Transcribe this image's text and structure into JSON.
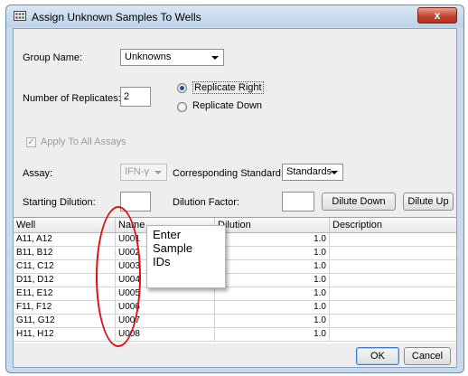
{
  "window": {
    "title": "Assign Unknown Samples To Wells",
    "close_glyph": "x",
    "icon": "plate-icon"
  },
  "form": {
    "group_name_label": "Group Name:",
    "group_name_value": "Unknowns",
    "replicates_label": "Number of Replicates:",
    "replicates_value": "2",
    "replicate_right_label": "Replicate Right",
    "replicate_down_label": "Replicate Down",
    "replicate_mode_selected": "Replicate Right",
    "apply_all_label": "Apply To All Assays",
    "apply_all_checked": true,
    "assay_label": "Assay:",
    "assay_value": "IFN-γ",
    "standard_label": "Corresponding Standard:",
    "standard_value": "Standards",
    "starting_dilution_label": "Starting Dilution:",
    "starting_dilution_value": "",
    "dilution_factor_label": "Dilution Factor:",
    "dilution_factor_value": "",
    "dilute_down_label": "Dilute Down",
    "dilute_up_label": "Dilute Up"
  },
  "table": {
    "columns": [
      "Well",
      "Name",
      "Dilution",
      "Description"
    ],
    "rows": [
      {
        "well": "A11, A12",
        "name": "U001",
        "dilution": "1.0",
        "description": ""
      },
      {
        "well": "B11, B12",
        "name": "U002",
        "dilution": "1.0",
        "description": ""
      },
      {
        "well": "C11, C12",
        "name": "U003",
        "dilution": "1.0",
        "description": ""
      },
      {
        "well": "D11, D12",
        "name": "U004",
        "dilution": "1.0",
        "description": ""
      },
      {
        "well": "E11, E12",
        "name": "U005",
        "dilution": "1.0",
        "description": ""
      },
      {
        "well": "F11, F12",
        "name": "U006",
        "dilution": "1.0",
        "description": ""
      },
      {
        "well": "G11, G12",
        "name": "U007",
        "dilution": "1.0",
        "description": ""
      },
      {
        "well": "H11, H12",
        "name": "U008",
        "dilution": "1.0",
        "description": ""
      }
    ]
  },
  "callout": {
    "lines": [
      "Enter",
      "Sample",
      "IDs"
    ]
  },
  "footer": {
    "ok_label": "OK",
    "cancel_label": "Cancel"
  },
  "colors": {
    "highlight_ellipse": "#e01010",
    "close_button": "#c1442e",
    "window_frame": "#c8daec"
  }
}
